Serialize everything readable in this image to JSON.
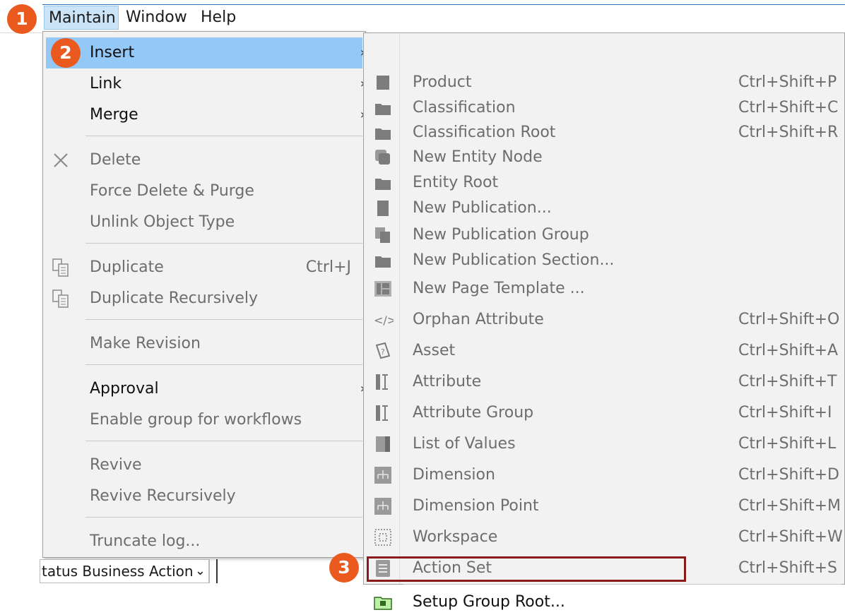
{
  "menubar": {
    "maintain": "Maintain",
    "window": "Window",
    "help": "Help"
  },
  "badges": {
    "b1": "1",
    "b2": "2",
    "b3": "3"
  },
  "main_menu": {
    "insert": "Insert",
    "link": "Link",
    "merge": "Merge",
    "delete": "Delete",
    "force_delete": "Force Delete & Purge",
    "unlink": "Unlink Object Type",
    "duplicate": "Duplicate",
    "duplicate_shortcut": "Ctrl+J",
    "duplicate_recursively": "Duplicate Recursively",
    "make_revision": "Make Revision",
    "approval": "Approval",
    "enable_group": "Enable group for workflows",
    "revive": "Revive",
    "revive_recursively": "Revive Recursively",
    "truncate_log": "Truncate log..."
  },
  "submenu": {
    "items": [
      {
        "label": "Product",
        "shortcut": "Ctrl+Shift+P",
        "icon": "product-icon"
      },
      {
        "label": "Classification",
        "shortcut": "Ctrl+Shift+C",
        "icon": "folder-icon"
      },
      {
        "label": "Classification Root",
        "shortcut": "Ctrl+Shift+R",
        "icon": "folder-icon"
      },
      {
        "label": "New Entity Node",
        "shortcut": "",
        "icon": "entity-node-icon"
      },
      {
        "label": "Entity Root",
        "shortcut": "",
        "icon": "folder-icon"
      },
      {
        "label": "New Publication...",
        "shortcut": "",
        "icon": "publication-icon"
      },
      {
        "label": "New Publication Group",
        "shortcut": "",
        "icon": "publication-group-icon"
      },
      {
        "label": "New Publication Section...",
        "shortcut": "",
        "icon": "folder-icon"
      },
      {
        "label": "New Page Template ...",
        "shortcut": "",
        "icon": "page-template-icon"
      },
      {
        "label": "Orphan Attribute",
        "shortcut": "Ctrl+Shift+O",
        "icon": "orphan-attribute-icon"
      },
      {
        "label": "Asset",
        "shortcut": "Ctrl+Shift+A",
        "icon": "asset-icon"
      },
      {
        "label": "Attribute",
        "shortcut": "Ctrl+Shift+T",
        "icon": "attribute-icon"
      },
      {
        "label": "Attribute Group",
        "shortcut": "Ctrl+Shift+I",
        "icon": "attribute-group-icon"
      },
      {
        "label": "List of Values",
        "shortcut": "Ctrl+Shift+L",
        "icon": "list-of-values-icon"
      },
      {
        "label": "Dimension",
        "shortcut": "Ctrl+Shift+D",
        "icon": "dimension-icon"
      },
      {
        "label": "Dimension Point",
        "shortcut": "Ctrl+Shift+M",
        "icon": "dimension-point-icon"
      },
      {
        "label": "Workspace",
        "shortcut": "Ctrl+Shift+W",
        "icon": "workspace-icon"
      },
      {
        "label": "Action Set",
        "shortcut": "Ctrl+Shift+S",
        "icon": "action-set-icon"
      },
      {
        "label": "Setup Group Root...",
        "shortcut": "",
        "icon": "setup-group-root-icon"
      }
    ]
  },
  "status_strip": {
    "text": "tatus Business Action"
  },
  "colors": {
    "badge": "#ea5a1e",
    "highlight": "#93c8f7",
    "frame": "#8b1a1a"
  }
}
